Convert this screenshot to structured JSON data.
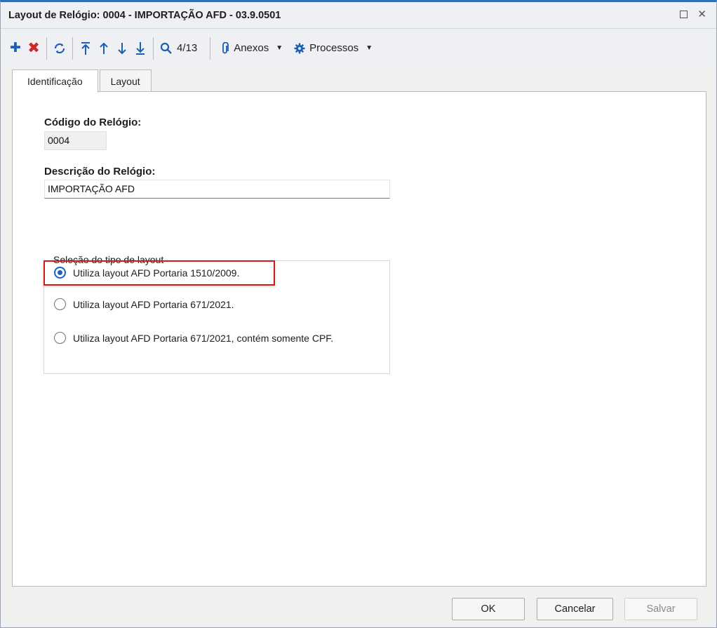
{
  "window": {
    "title": "Layout de Relógio: 0004 - IMPORTAÇÃO AFD - 03.9.0501"
  },
  "toolbar": {
    "record_position": "4/13",
    "attachments_label": "Anexos",
    "processes_label": "Processos"
  },
  "tabs": [
    {
      "label": "Identificação",
      "active": true
    },
    {
      "label": "Layout",
      "active": false
    }
  ],
  "form": {
    "code_label": "Código do Relógio:",
    "code_value": "0004",
    "description_label": "Descrição do Relógio:",
    "description_value": "IMPORTAÇÃO AFD"
  },
  "layout_group": {
    "legend": "Seleção do tipo de layout",
    "options": [
      {
        "label": "Utiliza layout AFD Portaria 1510/2009.",
        "selected": true
      },
      {
        "label": "Utiliza layout AFD Portaria 671/2021.",
        "selected": false
      },
      {
        "label": "Utiliza layout AFD Portaria 671/2021, contém somente CPF.",
        "selected": false
      }
    ]
  },
  "footer": {
    "ok_label": "OK",
    "cancel_label": "Cancelar",
    "save_label": "Salvar"
  },
  "colors": {
    "accent": "#1764c0",
    "delete": "#d0262c",
    "highlight": "#d21a1a"
  }
}
